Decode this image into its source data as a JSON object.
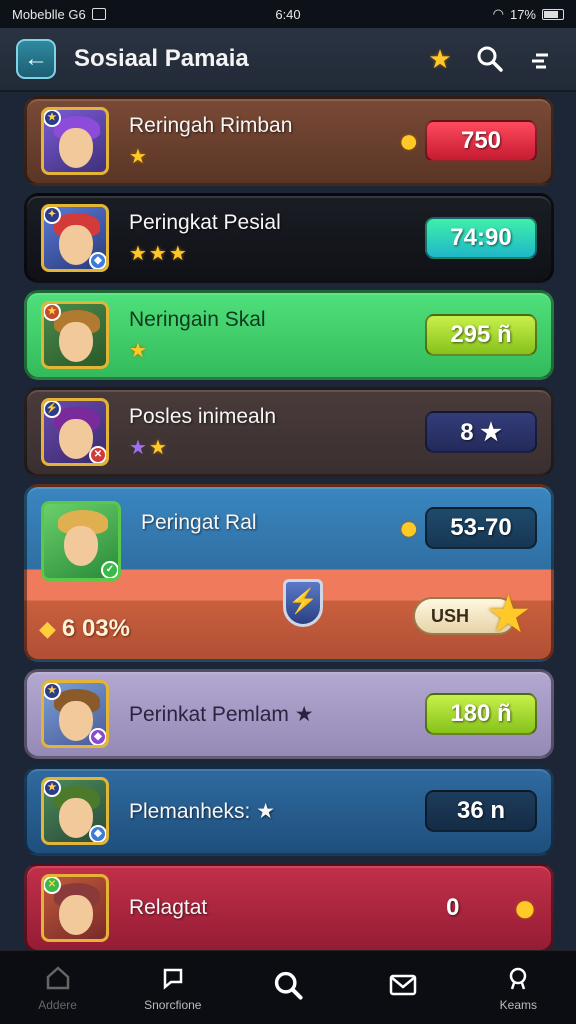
{
  "status_bar": {
    "carrier": "Mobeblle G6",
    "time": "6:40",
    "battery": "17%"
  },
  "header": {
    "title": "Sosiaal Pamaia",
    "back_icon": "arrow-left-icon",
    "star_icon": "star-icon",
    "search_icon": "search-icon",
    "menu_icon": "sort-icon"
  },
  "rows": [
    {
      "name": "Reringah Rimban",
      "stars": "★",
      "score": "750",
      "score_icon": "coin-icon"
    },
    {
      "name": "Peringkat Pesial",
      "stars": "★★★",
      "score": "74:90"
    },
    {
      "name": "Neringain Skal",
      "stars": "★",
      "score": "295 ñ"
    },
    {
      "name": "Posles inimealn",
      "stars": "★★",
      "score": "8 ★"
    },
    {
      "name": "Peringat Ral",
      "stars": "",
      "score": "53-70",
      "level": "6  03%",
      "action": "USH"
    },
    {
      "name": "Perinkat Pemlam ★",
      "stars": "",
      "score": "180 ñ"
    },
    {
      "name": "Plemanheks: ★",
      "stars": "",
      "score": "36 n"
    },
    {
      "name": "Relagtat",
      "stars": "",
      "score": "0"
    }
  ],
  "bottom_nav": [
    {
      "label": "Addere",
      "icon": "home-icon"
    },
    {
      "label": "Snorcfione",
      "icon": "chat-icon"
    },
    {
      "label": "",
      "icon": "search-icon"
    },
    {
      "label": "",
      "icon": "inbox-icon"
    },
    {
      "label": "Keams",
      "icon": "profile-icon"
    }
  ],
  "colors": {
    "accent_gold": "#ffc928",
    "background": "#1c2636"
  }
}
